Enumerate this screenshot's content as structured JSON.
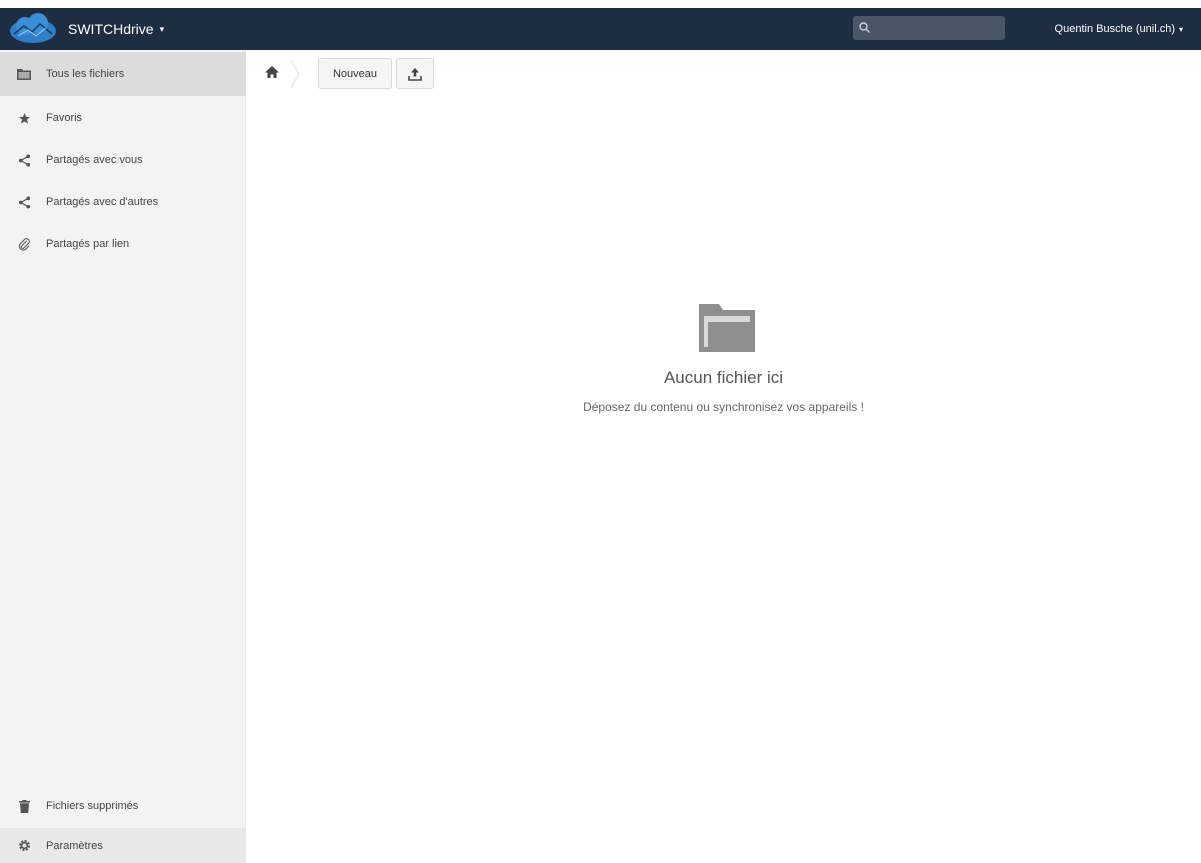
{
  "header": {
    "app_name": "SWITCHdrive",
    "app_caret": "▾",
    "search_placeholder": "",
    "user_name": "Quentin Busche (unil.ch)",
    "user_caret": "▾",
    "colors": {
      "bar": "#1e2d42",
      "accent": "#2e7fc7"
    }
  },
  "sidebar": {
    "items": [
      {
        "label": "Tous les fichiers",
        "icon": "folder-icon",
        "active": true
      },
      {
        "label": "Favoris",
        "icon": "star-icon"
      },
      {
        "label": "Partagés avec vous",
        "icon": "share-icon"
      },
      {
        "label": "Partagés avec d'autres",
        "icon": "share-icon"
      },
      {
        "label": "Partagés par lien",
        "icon": "link-icon"
      }
    ],
    "trash_label": "Fichiers supprimés",
    "settings_label": "Paramètres"
  },
  "toolbar": {
    "new_label": "Nouveau"
  },
  "empty": {
    "title": "Aucun fichier ici",
    "subtitle": "Déposez du contenu ou synchronisez vos appareils !"
  }
}
